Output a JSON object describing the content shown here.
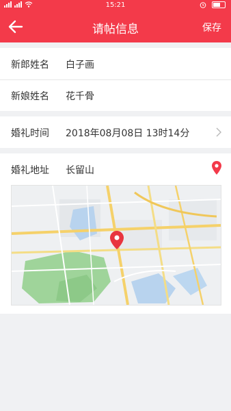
{
  "status_bar": {
    "time": "15:21"
  },
  "nav": {
    "title": "请帖信息",
    "save_label": "保存"
  },
  "form": {
    "groom": {
      "label": "新郎姓名",
      "value": "白子画"
    },
    "bride": {
      "label": "新娘姓名",
      "value": "花千骨"
    },
    "time": {
      "label": "婚礼时间",
      "value": "2018年08月08日 13时14分"
    },
    "address": {
      "label": "婚礼地址",
      "value": "长留山"
    }
  },
  "colors": {
    "accent": "#f33a4a",
    "background": "#f0f1f3"
  },
  "icons": {
    "back": "arrow-left-icon",
    "chevron": "chevron-right-icon",
    "location": "location-pin-icon"
  }
}
